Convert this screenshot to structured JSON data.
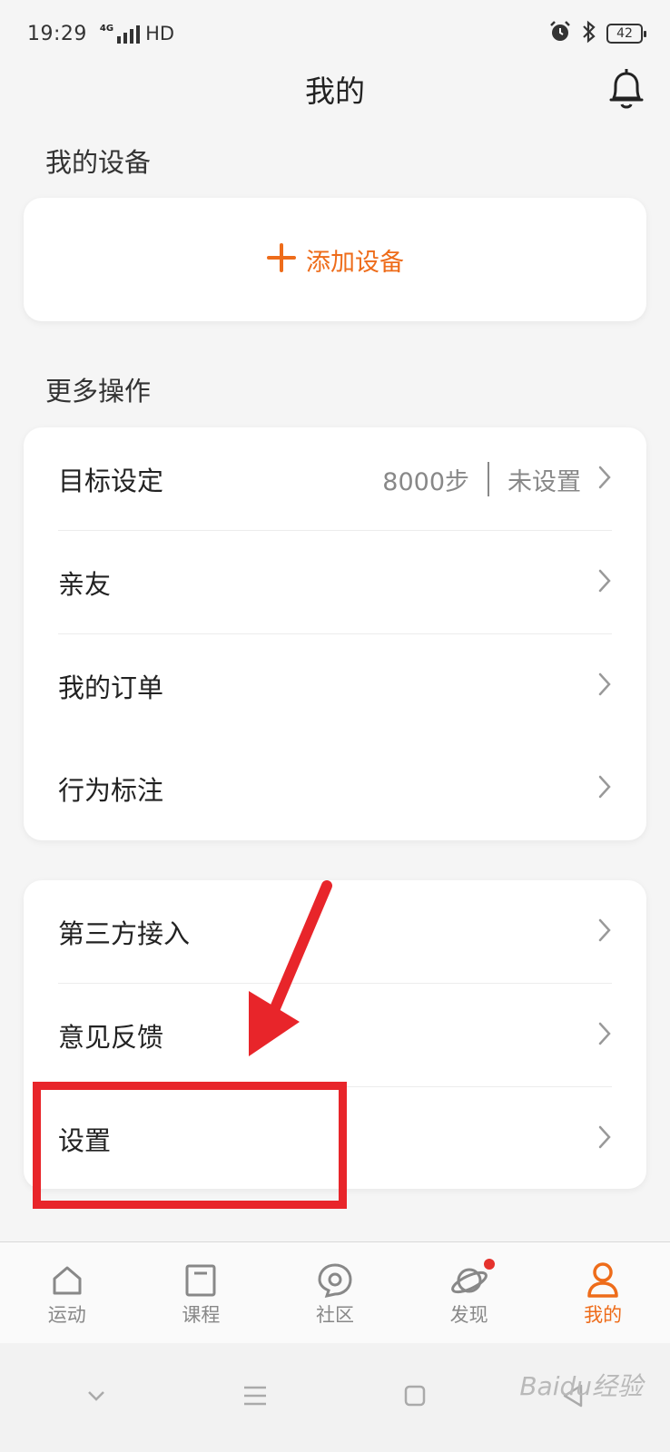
{
  "status_bar": {
    "time": "19:29",
    "network": "4G",
    "hd": "HD",
    "battery": "42"
  },
  "header": {
    "title": "我的"
  },
  "devices": {
    "section_title": "我的设备",
    "add_label": "添加设备"
  },
  "more": {
    "section_title": "更多操作",
    "items": [
      {
        "label": "目标设定",
        "value1": "8000步",
        "value2": "未设置"
      },
      {
        "label": "亲友"
      },
      {
        "label": "我的订单"
      },
      {
        "label": "行为标注"
      }
    ]
  },
  "others": {
    "items": [
      {
        "label": "第三方接入"
      },
      {
        "label": "意见反馈"
      },
      {
        "label": "设置"
      }
    ]
  },
  "tabbar": {
    "tabs": [
      {
        "label": "运动",
        "icon": "home-icon"
      },
      {
        "label": "课程",
        "icon": "book-icon"
      },
      {
        "label": "社区",
        "icon": "community-icon"
      },
      {
        "label": "发现",
        "icon": "planet-icon"
      },
      {
        "label": "我的",
        "icon": "person-icon"
      }
    ],
    "active": "我的"
  },
  "watermark": "Baidu经验",
  "colors": {
    "accent": "#ee6c1a",
    "annotation": "#e8252a",
    "background": "#f5f5f5"
  }
}
